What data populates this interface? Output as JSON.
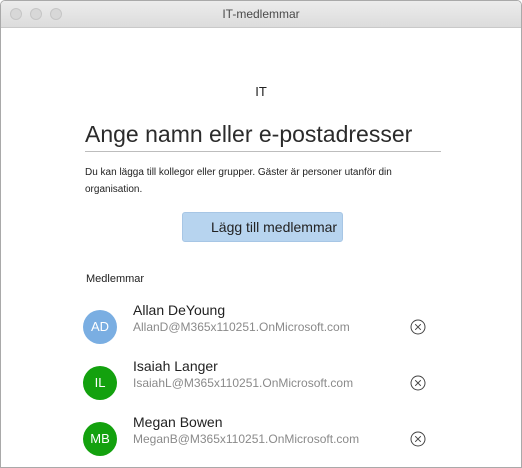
{
  "window": {
    "title": "IT-medlemmar"
  },
  "group": {
    "name": "IT"
  },
  "input": {
    "placeholder": "Ange namn eller e-postadresser",
    "value": ""
  },
  "hint": "Du kan lägga till kollegor eller grupper. Gäster är personer utanför din organisation.",
  "add_button_label": "Lägg till medlemmar",
  "members_label": "Medlemmar",
  "members": [
    {
      "initials": "AD",
      "name": "Allan DeYoung",
      "email": "AllanD@M365x110251.OnMicrosoft.com",
      "avatar_color": "#7aaee2",
      "remove_icon": "circle-x-icon"
    },
    {
      "initials": "IL",
      "name": "Isaiah Langer",
      "email": "IsaiahL@M365x110251.OnMicrosoft.com",
      "avatar_color": "#13a10e",
      "remove_icon": "circle-x-icon"
    },
    {
      "initials": "MB",
      "name": "Megan Bowen",
      "email": "MeganB@M365x110251.OnMicrosoft.com",
      "avatar_color": "#13a10e",
      "remove_icon": "circle-x-icon"
    }
  ],
  "colors": {
    "button_bg": "#b7d4ef",
    "titlebar_bg": "#e4e4e4"
  }
}
